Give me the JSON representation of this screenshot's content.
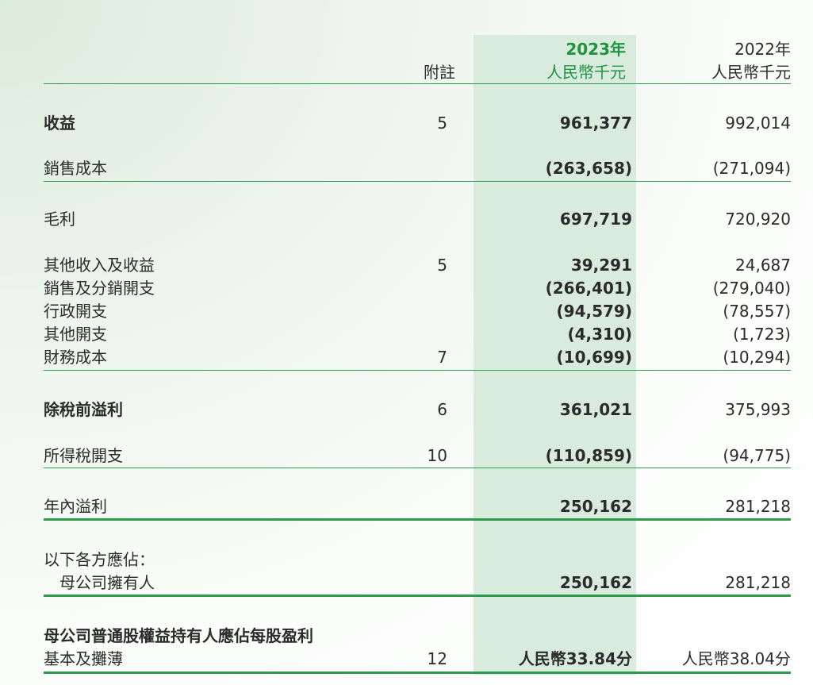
{
  "header": {
    "note_col": "附註",
    "year_current": "2023年",
    "currency_current": "人民幣千元",
    "year_prior": "2022年",
    "currency_prior": "人民幣千元"
  },
  "rows": [
    {
      "label": "收益",
      "note": "5",
      "v2023": "961,377",
      "v2022": "992,014"
    },
    {
      "label": "銷售成本",
      "note": "",
      "v2023": "(263,658)",
      "v2022": "(271,094)"
    },
    {
      "label": "毛利",
      "note": "",
      "v2023": "697,719",
      "v2022": "720,920"
    },
    {
      "label": "其他收入及收益",
      "note": "5",
      "v2023": "39,291",
      "v2022": "24,687"
    },
    {
      "label": "銷售及分銷開支",
      "note": "",
      "v2023": "(266,401)",
      "v2022": "(279,040)"
    },
    {
      "label": "行政開支",
      "note": "",
      "v2023": "(94,579)",
      "v2022": "(78,557)"
    },
    {
      "label": "其他開支",
      "note": "",
      "v2023": "(4,310)",
      "v2022": "(1,723)"
    },
    {
      "label": "財務成本",
      "note": "7",
      "v2023": "(10,699)",
      "v2022": "(10,294)"
    },
    {
      "label": "除稅前溢利",
      "note": "6",
      "v2023": "361,021",
      "v2022": "375,993"
    },
    {
      "label": "所得稅開支",
      "note": "10",
      "v2023": "(110,859)",
      "v2022": "(94,775)"
    },
    {
      "label": "年內溢利",
      "note": "",
      "v2023": "250,162",
      "v2022": "281,218"
    },
    {
      "label": "以下各方應佔：",
      "note": "",
      "v2023": "",
      "v2022": ""
    },
    {
      "label": "母公司擁有人",
      "note": "",
      "v2023": "250,162",
      "v2022": "281,218"
    },
    {
      "label": "母公司普通股權益持有人應佔每股盈利",
      "note": "",
      "v2023": "",
      "v2022": ""
    },
    {
      "label": "基本及攤薄",
      "note": "12",
      "v2023": "人民幣33.84分",
      "v2022": "人民幣38.04分"
    }
  ]
}
